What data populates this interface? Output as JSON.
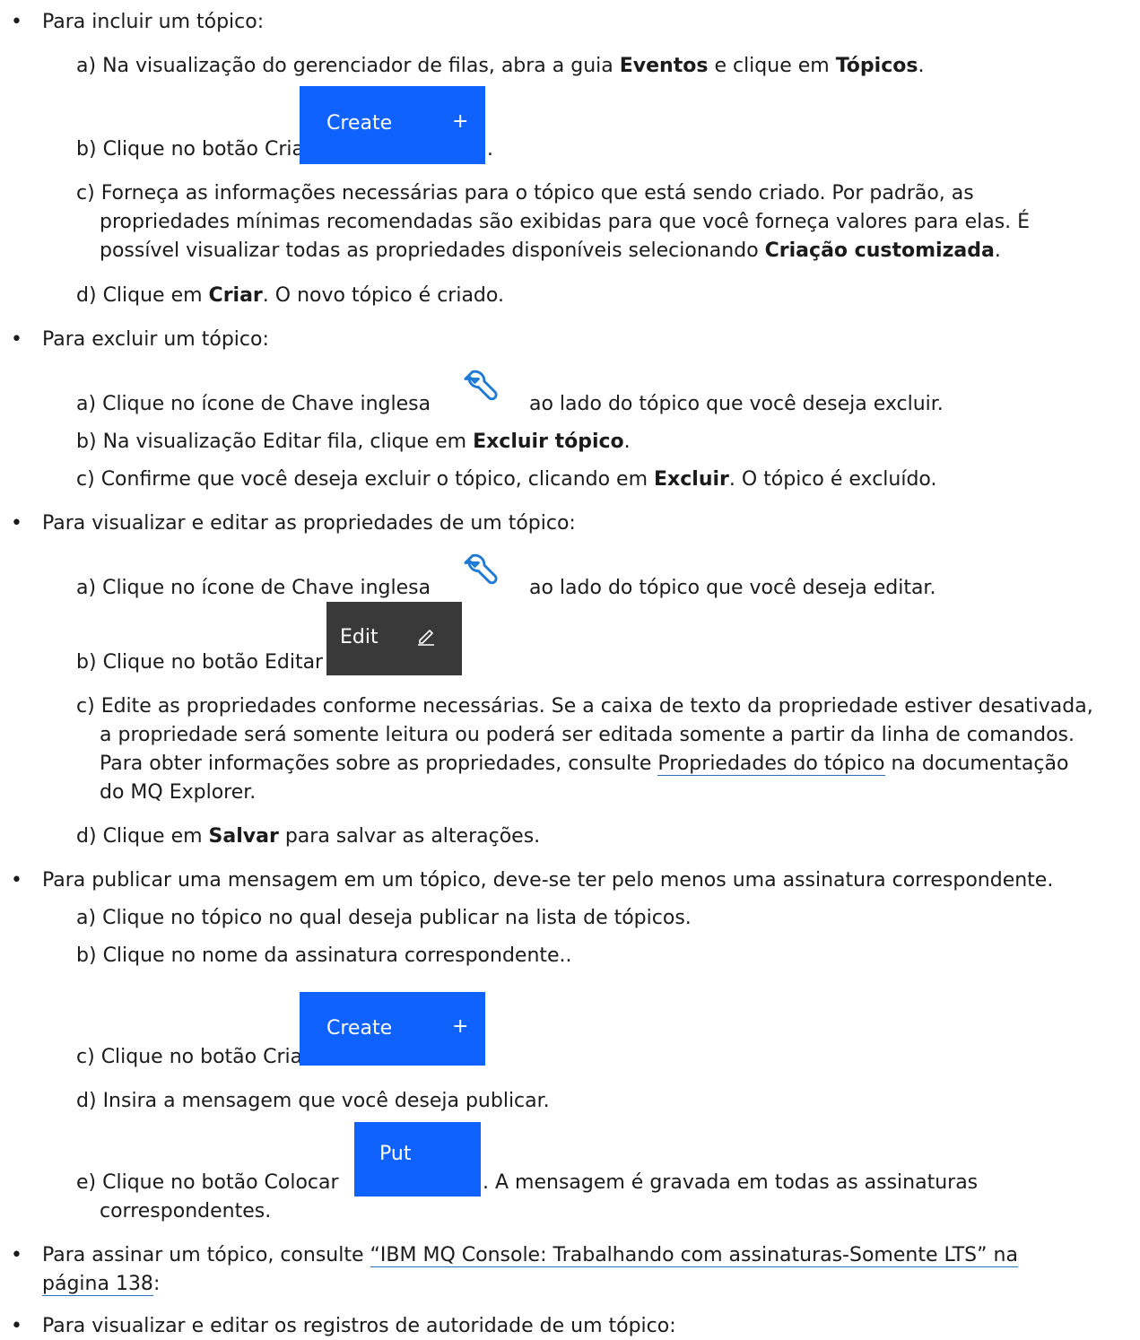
{
  "items": {
    "add": {
      "bullet": "•",
      "intro": "Para incluir um tópico:",
      "a": {
        "label": "a)",
        "t1": "Na visualização do gerenciador de filas, abra a guia ",
        "b1": "Eventos",
        "t2": " e clique em ",
        "b2": "Tópicos",
        "t3": "."
      },
      "b": {
        "label": "b)",
        "t1": "Clique no botão Criar",
        "btn_label": "Create",
        "btn_icon": "+",
        "after": "."
      },
      "c": {
        "label": "c)",
        "l1": "Forneça as informações necessárias para o tópico que está sendo criado. Por padrão, as",
        "l2": "propriedades mínimas recomendadas são exibidas para que você forneça valores para elas. É",
        "l3": "possível visualizar todas as propriedades disponíveis selecionando ",
        "l3b": "Criação customizada",
        "l3c": "."
      },
      "d": {
        "label": "d)",
        "t1": "Clique em ",
        "b1": "Criar",
        "t2": ". O novo tópico é criado."
      }
    },
    "delete": {
      "bullet": "•",
      "intro": "Para excluir um tópico:",
      "a": {
        "label": "a)",
        "t1": "Clique no ícone de Chave inglesa",
        "t2": "ao lado do tópico que você deseja excluir."
      },
      "b": {
        "label": "b)",
        "t1": "Na visualização Editar fila, clique em ",
        "b1": "Excluir tópico",
        "t2": "."
      },
      "c": {
        "label": "c)",
        "t1": "Confirme que você deseja excluir o tópico, clicando em ",
        "b1": "Excluir",
        "t2": ". O tópico é excluído."
      }
    },
    "edit": {
      "bullet": "•",
      "intro": "Para visualizar e editar as propriedades de um tópico:",
      "a": {
        "label": "a)",
        "t1": "Clique no ícone de Chave inglesa",
        "t2": "ao lado do tópico que você deseja editar."
      },
      "b": {
        "label": "b)",
        "t1": "Clique no botão Editar",
        "btn_label": "Edit",
        "btn_icon": "pencil-icon"
      },
      "c": {
        "label": "c)",
        "l1": "Edite as propriedades conforme necessárias. Se a caixa de texto da propriedade estiver desativada,",
        "l2": "a propriedade será somente leitura ou poderá ser editada somente a partir da linha de comandos.",
        "l3a": "Para obter informações sobre as propriedades, consulte ",
        "l3link": "Propriedades do tópico",
        "l3b": " na documentação",
        "l4": "do MQ Explorer."
      },
      "d": {
        "label": "d)",
        "t1": "Clique em ",
        "b1": "Salvar",
        "t2": " para salvar as alterações."
      }
    },
    "publish": {
      "bullet": "•",
      "intro": "Para publicar uma mensagem em um tópico, deve-se ter pelo menos uma assinatura correspondente.",
      "a": {
        "label": "a)",
        "t1": "Clique no tópico no qual deseja publicar na lista de tópicos."
      },
      "b": {
        "label": "b)",
        "t1": "Clique no nome da assinatura correspondente.."
      },
      "c": {
        "label": "c)",
        "t1": "Clique no botão Criar",
        "btn_label": "Create",
        "btn_icon": "+"
      },
      "d": {
        "label": "d)",
        "t1": "Insira a mensagem que você deseja publicar."
      },
      "e": {
        "label": "e)",
        "t1": "Clique no botão Colocar",
        "btn_label": "Put",
        "t2": ". A mensagem é gravada em todas as assinaturas",
        "l2": "correspondentes."
      }
    },
    "subscribe": {
      "bullet": "•",
      "t1": "Para assinar um tópico, consulte ",
      "link1": "“IBM MQ Console: Trabalhando com assinaturas-Somente LTS” na",
      "link2": "página 138",
      "t2": ":"
    },
    "authority": {
      "bullet": "•",
      "intro": "Para visualizar e editar os registros de autoridade de um tópico:"
    }
  },
  "colors": {
    "primary_button": "#0f62fe",
    "edit_button": "#393939",
    "wrench": "#1f7ad6",
    "link_underline": "#2d6fb8"
  }
}
